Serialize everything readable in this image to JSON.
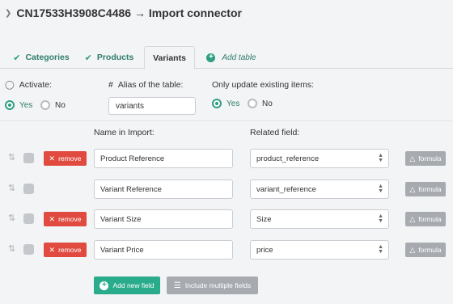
{
  "header": {
    "title": "CN17533H3908C4486 → Import connector"
  },
  "tabs": [
    {
      "label": "Categories",
      "icon": "check-icon",
      "state": "inactive"
    },
    {
      "label": "Products",
      "icon": "check-icon",
      "state": "inactive"
    },
    {
      "label": "Variants",
      "icon": "",
      "state": "active"
    },
    {
      "label": "Add table",
      "icon": "plus-circle-icon",
      "state": "inactive"
    }
  ],
  "settings": {
    "activate_label": "Activate:",
    "activate_options": [
      "Yes",
      "No"
    ],
    "activate_selected": "Yes",
    "alias_label": "Alias of the table:",
    "alias_value": "variants",
    "only_update_label": "Only update existing items:",
    "only_update_options": [
      "Yes",
      "No"
    ],
    "only_update_selected": "Yes"
  },
  "table": {
    "col_name": "Name in Import:",
    "col_related": "Related field:",
    "rows": [
      {
        "name": "Product Reference",
        "related": "product_reference",
        "removable": true
      },
      {
        "name": "Variant Reference",
        "related": "variant_reference",
        "removable": false
      },
      {
        "name": "Variant Size",
        "related": "Size",
        "removable": true
      },
      {
        "name": "Variant Price",
        "related": "price",
        "removable": true
      }
    ],
    "remove_label": "remove",
    "formula_label": "formula"
  },
  "actions": {
    "add_field_label": "Add new field",
    "include_multiple_label": "Include multiple fields"
  },
  "colors": {
    "accent": "#2e9e83",
    "danger": "#e04a3f",
    "muted_button": "#a7abb0",
    "background": "#f3f4f6"
  }
}
